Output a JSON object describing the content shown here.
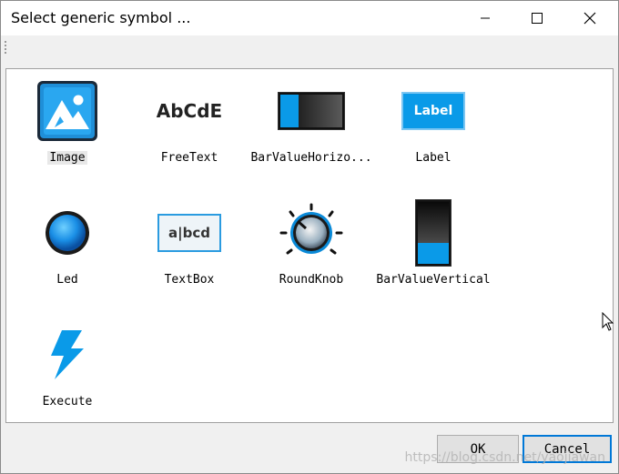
{
  "window": {
    "title": "Select generic symbol ..."
  },
  "symbols": [
    {
      "label": "Image",
      "icon": "image-icon",
      "selected": true
    },
    {
      "label": "FreeText",
      "icon": "free-text-icon",
      "preview_text": "AbCdE"
    },
    {
      "label": "BarValueHorizo...",
      "icon": "bar-value-horizontal-icon"
    },
    {
      "label": "Label",
      "icon": "label-icon",
      "preview_text": "Label"
    },
    {
      "label": "Led",
      "icon": "led-icon"
    },
    {
      "label": "TextBox",
      "icon": "textbox-icon",
      "preview_text": "a|bcd"
    },
    {
      "label": "RoundKnob",
      "icon": "round-knob-icon"
    },
    {
      "label": "BarValueVertical",
      "icon": "bar-value-vertical-icon"
    },
    {
      "label": "Execute",
      "icon": "execute-icon"
    }
  ],
  "buttons": {
    "ok": "OK",
    "cancel": "Cancel"
  },
  "watermark": "https://blog.csdn.net/yaojiawan",
  "colors": {
    "accent": "#0095e8",
    "button_default_border": "#0078d7"
  }
}
